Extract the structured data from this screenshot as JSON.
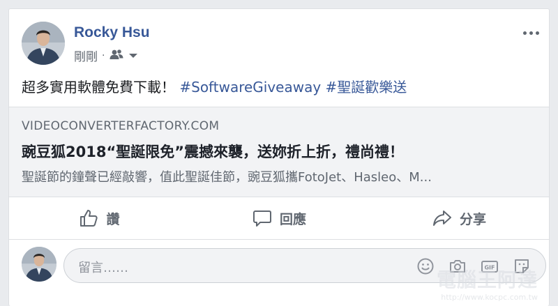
{
  "post": {
    "author": "Rocky Hsu",
    "time": "剛剛",
    "dot": "·",
    "text": "超多實用軟體免費下載！",
    "hashtags": [
      "#SoftwareGiveaway",
      "#聖誕歡樂送"
    ]
  },
  "link": {
    "domain": "VIDEOCONVERTERFACTORY.COM",
    "title": "豌豆狐2018“聖誕限免”震撼來襲，送妳折上折，禮尚禮！",
    "description": "聖誕節的鐘聲已經敲響，值此聖誕佳節，豌豆狐攜FotoJet、Hasleo、M..."
  },
  "actions": {
    "like": "讚",
    "comment": "回應",
    "share": "分享"
  },
  "comment": {
    "placeholder": "留言……",
    "icons": [
      "emoji-icon",
      "camera-icon",
      "gif-icon",
      "sticker-icon"
    ]
  },
  "watermark": {
    "title": "電腦王阿達",
    "url": "http://www.kocpc.com.tw"
  },
  "colors": {
    "link": "#385898",
    "text": "#1c1e21",
    "muted": "#606770",
    "preview_bg": "#f2f3f5"
  }
}
